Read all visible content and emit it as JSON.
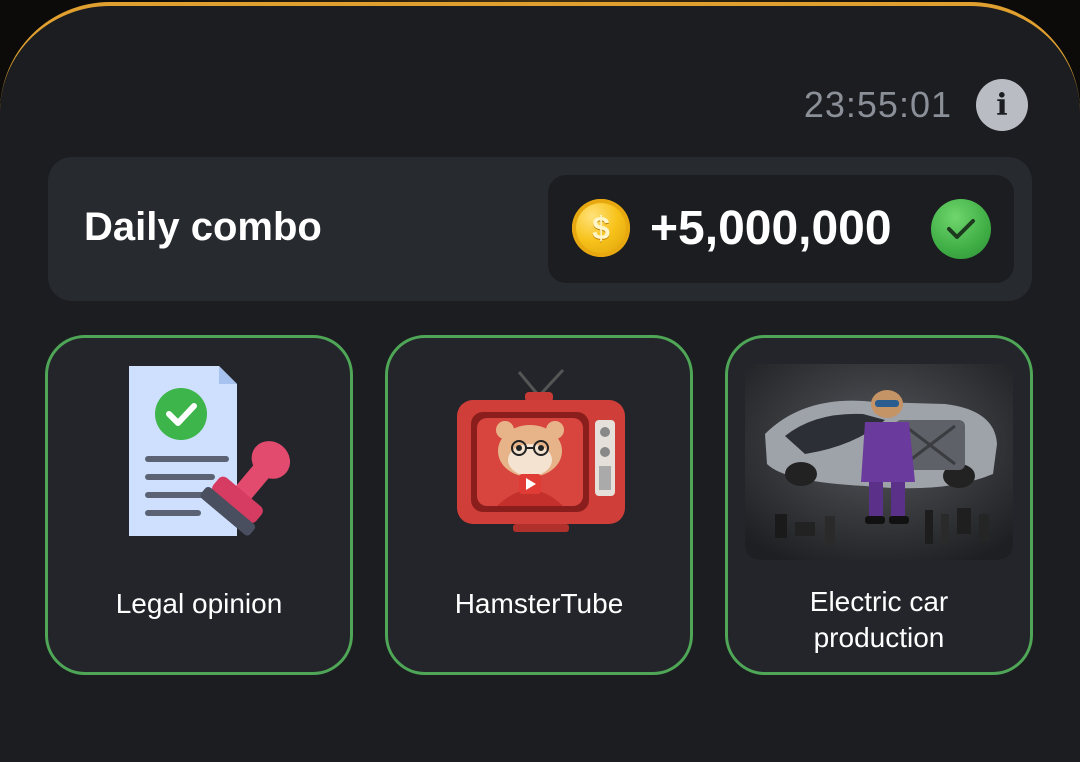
{
  "timer": "23:55:01",
  "info_icon": "i",
  "daily_combo": {
    "title": "Daily combo",
    "coin_symbol": "$",
    "reward": "+5,000,000",
    "completed": true
  },
  "cards": [
    {
      "label": "Legal opinion",
      "image": "legal-document-stamp"
    },
    {
      "label": "HamsterTube",
      "image": "hamster-tv"
    },
    {
      "label_line1": "Electric car",
      "label_line2": "production",
      "image": "hamster-electric-car"
    }
  ],
  "colors": {
    "accent_gold": "#e0a030",
    "card_border": "#4ea656",
    "panel": "#1b1d21",
    "check_green": "#3fae45"
  }
}
